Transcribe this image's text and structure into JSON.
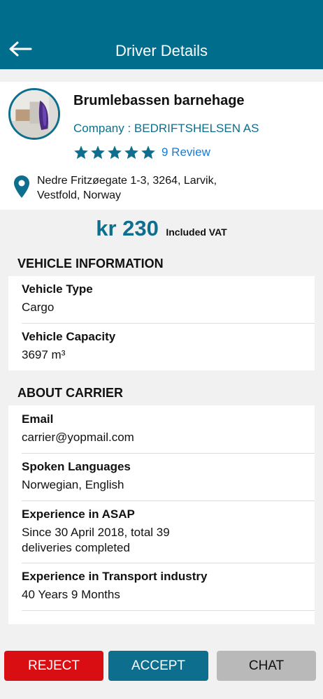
{
  "header": {
    "title": "Driver Details"
  },
  "profile": {
    "name": "Brumlebassen barnehage",
    "company": "Company : BEDRIFTSHELSEN AS",
    "rating_stars": 5,
    "review_label": "9 Review",
    "address": "Nedre Fritzøegate 1-3, 3264, Larvik, Vestfold, Norway"
  },
  "price": {
    "amount": "kr 230",
    "note": "Included VAT"
  },
  "vehicle": {
    "section_title": "VEHICLE INFORMATION",
    "type_label": "Vehicle Type",
    "type_value": "Cargo",
    "capacity_label": "Vehicle Capacity",
    "capacity_value": "3697 m³"
  },
  "carrier": {
    "section_title": "ABOUT CARRIER",
    "email_label": "Email",
    "email_value": "carrier@yopmail.com",
    "languages_label": "Spoken Languages",
    "languages_value": "Norwegian, English",
    "asap_label": "Experience in ASAP",
    "asap_value": "Since 30 April 2018, total 39 deliveries completed",
    "transport_label": "Experience in Transport industry",
    "transport_value": "40 Years 9 Months"
  },
  "actions": {
    "reject": "REJECT",
    "accept": "ACCEPT",
    "chat": "CHAT"
  },
  "colors": {
    "brand": "#006d8c",
    "accent_text": "#0d6f8d",
    "link": "#1a7bd3",
    "reject": "#d90e12",
    "chat": "#b9b9b9"
  },
  "icons": {
    "back": "arrow-left-icon",
    "star": "star-icon",
    "location": "map-pin-icon"
  }
}
